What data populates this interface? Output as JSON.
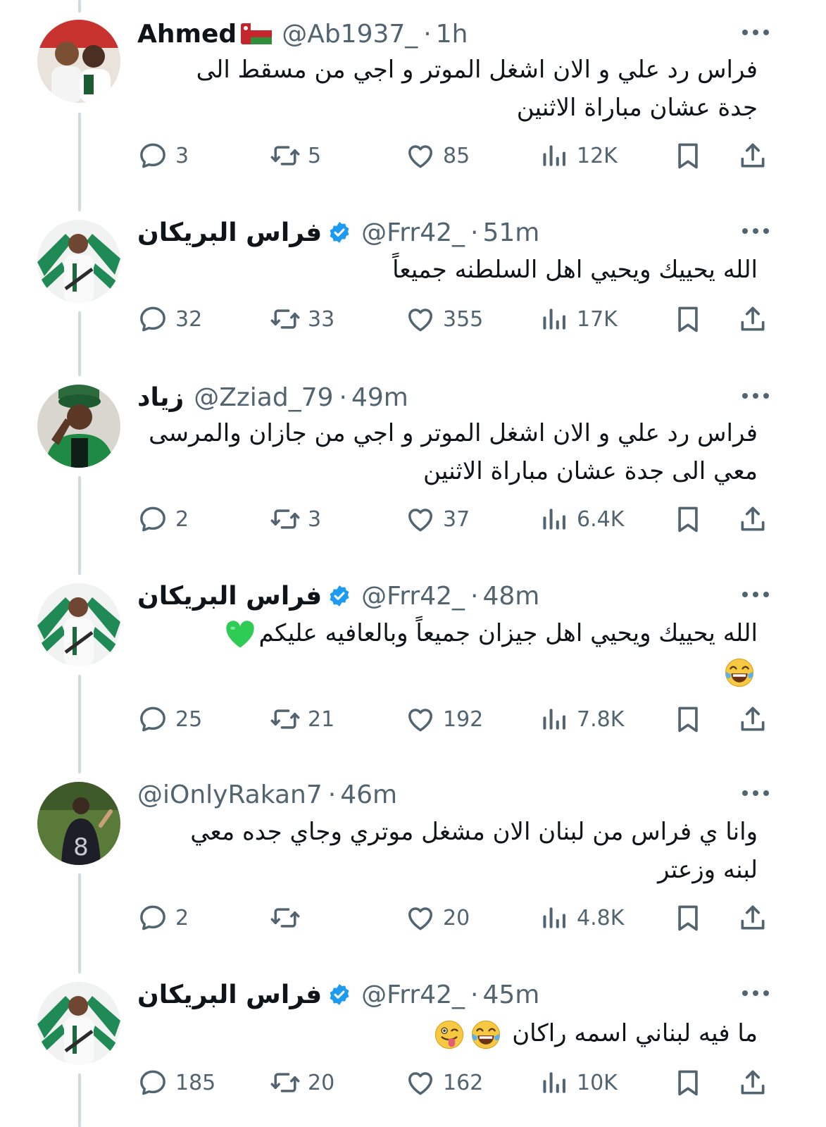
{
  "colors": {
    "text": "#0f1419",
    "secondary": "#536471",
    "verified": "#1d9bf0",
    "thread_line": "#cfd9de"
  },
  "tweets": [
    {
      "name": "Ahmed",
      "name_icon": "oman-flag-icon",
      "handle": "@Ab1937_",
      "sep": "·",
      "time": "1h",
      "lines": [
        "فراس رد علي و الان اشغل الموتر و اجي من مسقط الى",
        "جدة عشان مباراة الاثنين"
      ],
      "replies": "3",
      "reposts": "5",
      "likes": "85",
      "views": "12K"
    },
    {
      "name": "فراس البريكان",
      "name_icon": "verified-badge-icon",
      "handle": "@Frr42_",
      "sep": "·",
      "time": "51m",
      "lines": [
        "الله يحييك ويحيي اهل السلطنه جميعاً"
      ],
      "replies": "32",
      "reposts": "33",
      "likes": "355",
      "views": "17K"
    },
    {
      "name": "زياد",
      "name_icon": "",
      "handle": "@Zziad_79",
      "sep": "·",
      "time": "49m",
      "lines": [
        "فراس رد علي و الان اشغل الموتر و اجي من جازان والمرسى",
        "معي الى جدة عشان مباراة الاثنين"
      ],
      "replies": "2",
      "reposts": "3",
      "likes": "37",
      "views": "6.4K"
    },
    {
      "name": "فراس البريكان",
      "name_icon": "verified-badge-icon",
      "handle": "@Frr42_",
      "sep": "·",
      "time": "48m",
      "lines": [
        "الله يحييك ويحيي اهل جيزان جميعاً وبالعافيه عليكم",
        ""
      ],
      "emojis": [
        "green-heart-emoji",
        "tears-of-joy-emoji"
      ],
      "replies": "25",
      "reposts": "21",
      "likes": "192",
      "views": "7.8K"
    },
    {
      "name": "",
      "name_icon": "",
      "handle": "@iOnlyRakan7",
      "sep": "·",
      "time": "46m",
      "lines": [
        "وانا ي فراس من لبنان الان مشغل موتري وجاي جده معي",
        "لبنه وزعتر"
      ],
      "replies": "2",
      "reposts": "",
      "likes": "20",
      "views": "4.8K"
    },
    {
      "name": "فراس البريكان",
      "name_icon": "verified-badge-icon",
      "handle": "@Frr42_",
      "sep": "·",
      "time": "45m",
      "lines": [
        "ما فيه لبناني اسمه راكان"
      ],
      "emojis": [
        "tears-of-joy-emoji",
        "winking-tongue-emoji"
      ],
      "replies": "185",
      "reposts": "20",
      "likes": "162",
      "views": "10K"
    }
  ]
}
